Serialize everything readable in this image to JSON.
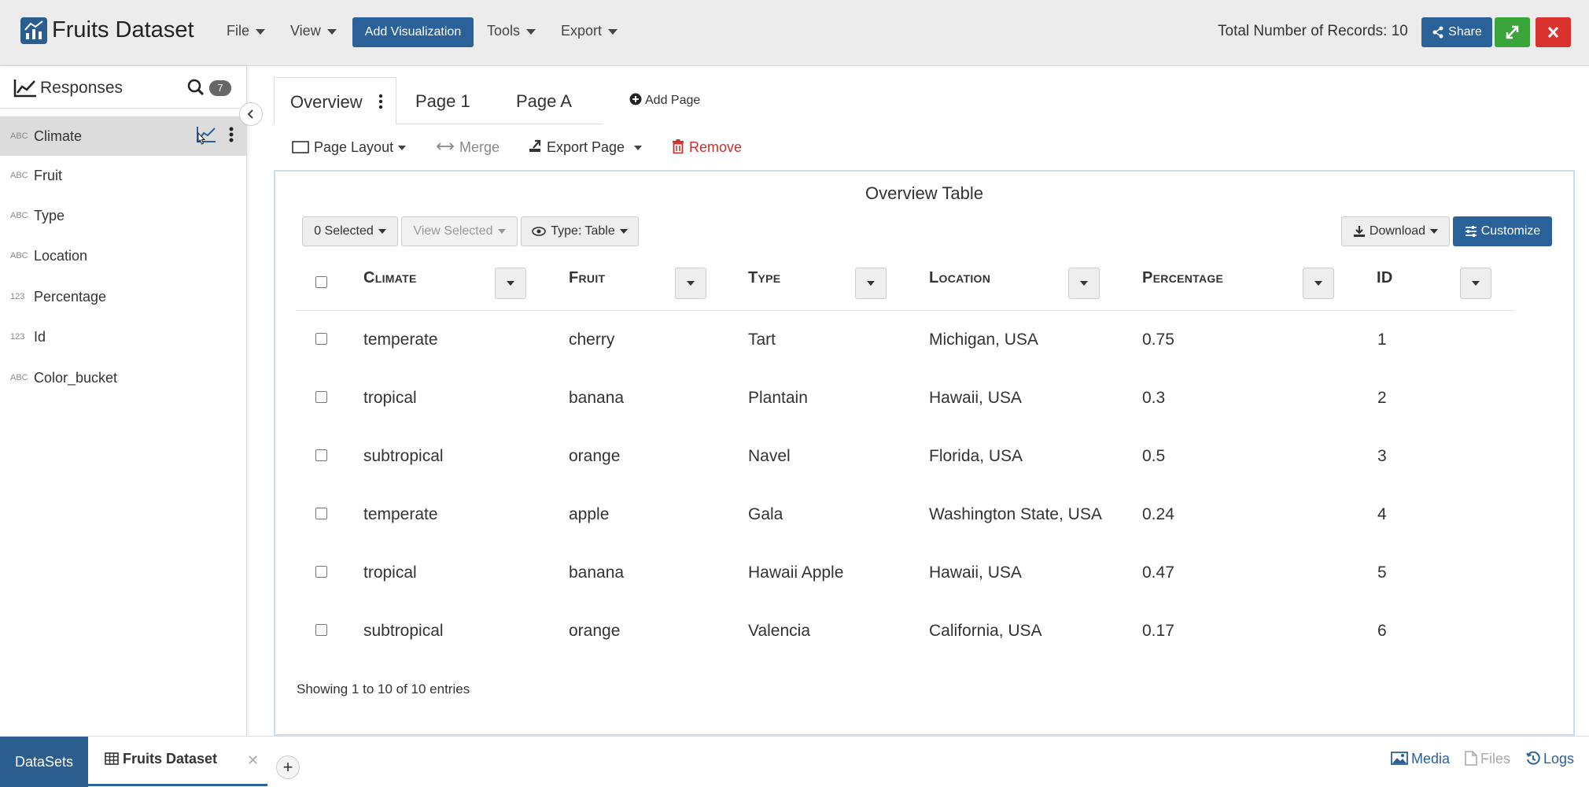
{
  "header": {
    "title": "Fruits Dataset",
    "menus": [
      "File",
      "View",
      "Tools",
      "Export"
    ],
    "add_visualization": "Add Visualization",
    "records_label": "Total Number of Records: 10",
    "share": "Share"
  },
  "sidebar": {
    "title": "Responses",
    "count": "7",
    "items": [
      {
        "type": "ABC",
        "label": "Climate"
      },
      {
        "type": "ABC",
        "label": "Fruit"
      },
      {
        "type": "ABC",
        "label": "Type"
      },
      {
        "type": "ABC",
        "label": "Location"
      },
      {
        "type": "123",
        "label": "Percentage"
      },
      {
        "type": "123",
        "label": "Id"
      },
      {
        "type": "ABC",
        "label": "Color_bucket"
      }
    ]
  },
  "tabs": [
    "Overview",
    "Page 1",
    "Page A"
  ],
  "add_page": "Add Page",
  "toolbar": {
    "page_layout": "Page Layout",
    "merge": "Merge",
    "export_page": "Export Page",
    "remove": "Remove"
  },
  "panel": {
    "title": "Overview Table",
    "selected": "0 Selected",
    "view_selected": "View Selected",
    "type_table": "Type: Table",
    "download": "Download",
    "customize": "Customize"
  },
  "table": {
    "columns": [
      "Climate",
      "Fruit",
      "Type",
      "Location",
      "Percentage",
      "ID"
    ],
    "rows": [
      [
        "temperate",
        "cherry",
        "Tart",
        "Michigan, USA",
        "0.75",
        "1"
      ],
      [
        "tropical",
        "banana",
        "Plantain",
        "Hawaii, USA",
        "0.3",
        "2"
      ],
      [
        "subtropical",
        "orange",
        "Navel",
        "Florida, USA",
        "0.5",
        "3"
      ],
      [
        "temperate",
        "apple",
        "Gala",
        "Washington State, USA",
        "0.24",
        "4"
      ],
      [
        "tropical",
        "banana",
        "Hawaii Apple",
        "Hawaii, USA",
        "0.47",
        "5"
      ],
      [
        "subtropical",
        "orange",
        "Valencia",
        "California, USA",
        "0.17",
        "6"
      ]
    ],
    "footer": "Showing 1 to 10 of 10 entries"
  },
  "bottom": {
    "datasets": "DataSets",
    "tab_label": "Fruits Dataset",
    "media": "Media",
    "files": "Files",
    "logs": "Logs"
  },
  "colors": {
    "primary": "#2b6199",
    "success": "#3aa53a",
    "danger": "#d9322f",
    "remove_text": "#c9302c",
    "panel_border": "#c7dcec"
  }
}
